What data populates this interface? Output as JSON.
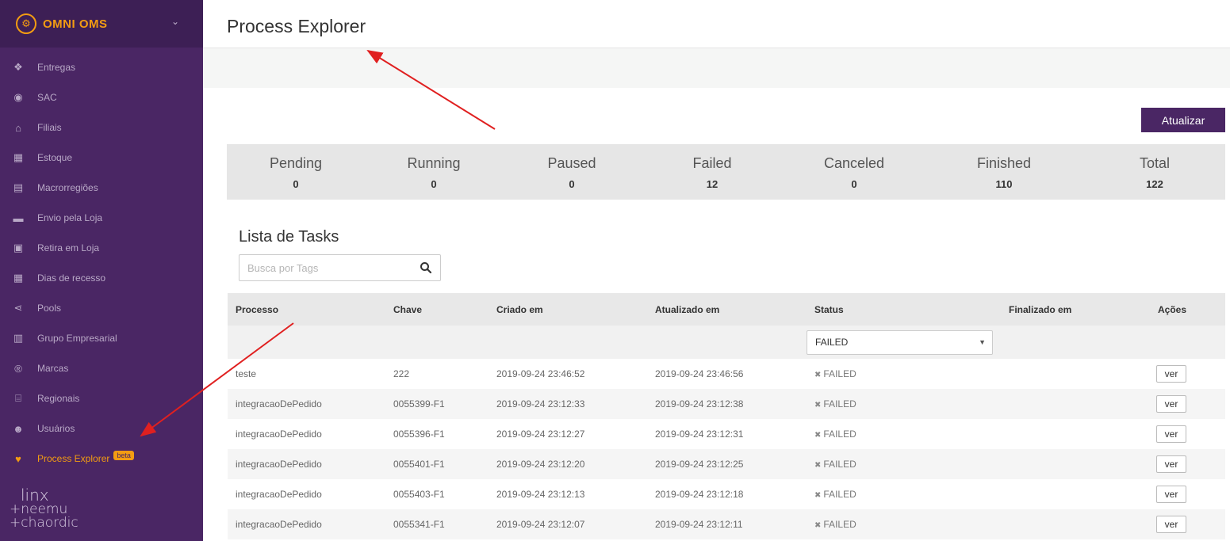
{
  "app": {
    "name": "OMNI OMS"
  },
  "sidebar": {
    "items": [
      {
        "label": "Entregas",
        "icon": "dropbox-icon",
        "glyph": "❖"
      },
      {
        "label": "SAC",
        "icon": "user-circle-icon",
        "glyph": "◉"
      },
      {
        "label": "Filiais",
        "icon": "home-icon",
        "glyph": "⌂"
      },
      {
        "label": "Estoque",
        "icon": "cubes-icon",
        "glyph": "▦"
      },
      {
        "label": "Macrorregiões",
        "icon": "map-icon",
        "glyph": "▤"
      },
      {
        "label": "Envio pela Loja",
        "icon": "truck-icon",
        "glyph": "▬"
      },
      {
        "label": "Retira em Loja",
        "icon": "shopping-bag-icon",
        "glyph": "▣"
      },
      {
        "label": "Dias de recesso",
        "icon": "calendar-icon",
        "glyph": "▦"
      },
      {
        "label": "Pools",
        "icon": "share-icon",
        "glyph": "⋖"
      },
      {
        "label": "Grupo Empresarial",
        "icon": "building-icon",
        "glyph": "▥"
      },
      {
        "label": "Marcas",
        "icon": "registered-icon",
        "glyph": "®"
      },
      {
        "label": "Regionais",
        "icon": "bank-icon",
        "glyph": "⌸"
      },
      {
        "label": "Usuários",
        "icon": "users-icon",
        "glyph": "☻"
      },
      {
        "label": "Process Explorer",
        "icon": "heartbeat-icon",
        "glyph": "♥",
        "badge": "beta",
        "active": true
      }
    ],
    "footer": {
      "line1": "linx",
      "line2": "+neemu",
      "line3": "+chaordic"
    }
  },
  "header": {
    "title": "Process Explorer"
  },
  "toolbar": {
    "update_label": "Atualizar"
  },
  "stats": [
    {
      "label": "Pending",
      "value": "0"
    },
    {
      "label": "Running",
      "value": "0"
    },
    {
      "label": "Paused",
      "value": "0"
    },
    {
      "label": "Failed",
      "value": "12"
    },
    {
      "label": "Canceled",
      "value": "0"
    },
    {
      "label": "Finished",
      "value": "110"
    },
    {
      "label": "Total",
      "value": "122"
    }
  ],
  "tasks": {
    "title": "Lista de Tasks",
    "search_placeholder": "Busca por Tags",
    "columns": [
      "Processo",
      "Chave",
      "Criado em",
      "Atualizado em",
      "Status",
      "Finalizado em",
      "Ações"
    ],
    "status_filter": "FAILED",
    "rows": [
      {
        "processo": "teste",
        "chave": "222",
        "criado": "2019-09-24 23:46:52",
        "atualizado": "2019-09-24 23:46:56",
        "status": "FAILED",
        "finalizado": "",
        "action": "ver"
      },
      {
        "processo": "integracaoDePedido",
        "chave": "0055399-F1",
        "criado": "2019-09-24 23:12:33",
        "atualizado": "2019-09-24 23:12:38",
        "status": "FAILED",
        "finalizado": "",
        "action": "ver"
      },
      {
        "processo": "integracaoDePedido",
        "chave": "0055396-F1",
        "criado": "2019-09-24 23:12:27",
        "atualizado": "2019-09-24 23:12:31",
        "status": "FAILED",
        "finalizado": "",
        "action": "ver"
      },
      {
        "processo": "integracaoDePedido",
        "chave": "0055401-F1",
        "criado": "2019-09-24 23:12:20",
        "atualizado": "2019-09-24 23:12:25",
        "status": "FAILED",
        "finalizado": "",
        "action": "ver"
      },
      {
        "processo": "integracaoDePedido",
        "chave": "0055403-F1",
        "criado": "2019-09-24 23:12:13",
        "atualizado": "2019-09-24 23:12:18",
        "status": "FAILED",
        "finalizado": "",
        "action": "ver"
      },
      {
        "processo": "integracaoDePedido",
        "chave": "0055341-F1",
        "criado": "2019-09-24 23:12:07",
        "atualizado": "2019-09-24 23:12:11",
        "status": "FAILED",
        "finalizado": "",
        "action": "ver"
      }
    ]
  },
  "colors": {
    "sidebar": "#4a2664",
    "brand": "#3d1f55",
    "accent": "#f39c12",
    "annotation_arrow": "#e02020"
  }
}
